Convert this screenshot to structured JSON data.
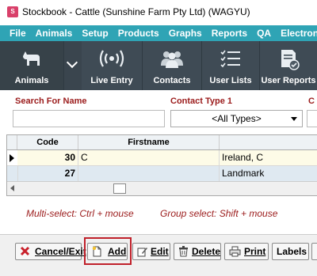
{
  "window": {
    "title": "Stockbook - Cattle (Sunshine Farm Pty Ltd) (WAGYU)",
    "icon": "app-logo-icon"
  },
  "menu": [
    {
      "label": "File"
    },
    {
      "label": "Animals"
    },
    {
      "label": "Setup"
    },
    {
      "label": "Products"
    },
    {
      "label": "Graphs"
    },
    {
      "label": "Reports"
    },
    {
      "label": "QA"
    },
    {
      "label": "Electronic"
    }
  ],
  "toolbar": {
    "animals": {
      "label": "Animals",
      "icon": "cow-icon"
    },
    "live_entry": {
      "label": "Live Entry",
      "icon": "wireless-signal-icon"
    },
    "contacts": {
      "label": "Contacts",
      "icon": "people-icon"
    },
    "user_lists": {
      "label": "User Lists",
      "icon": "checklist-icon"
    },
    "user_reports": {
      "label": "User Reports",
      "icon": "report-icon"
    }
  },
  "search": {
    "name_label": "Search For Name",
    "name_value": "",
    "contact_type_label": "Contact Type 1",
    "contact_type_value": "<All Types>",
    "third_label": "C"
  },
  "grid": {
    "columns": [
      "Code",
      "Firstname",
      ""
    ],
    "rows": [
      {
        "code": "30",
        "firstname": "C",
        "last": "Ireland, C",
        "current": true
      },
      {
        "code": "27",
        "firstname": "",
        "last": "Landmark",
        "current": false
      }
    ]
  },
  "hints": {
    "multi": "Multi-select: Ctrl + mouse",
    "group": "Group select: Shift + mouse"
  },
  "buttons": {
    "cancel": {
      "label": "Cancel/Exit",
      "icon": "x-icon"
    },
    "add": {
      "label": "Add",
      "icon": "new-document-icon"
    },
    "edit": {
      "label": "Edit",
      "icon": "edit-icon"
    },
    "delete": {
      "label": "Delete",
      "icon": "trash-icon"
    },
    "print": {
      "label": "Print",
      "icon": "printer-icon"
    },
    "labels": {
      "label": "Labels"
    }
  },
  "colors": {
    "menubar": "#2fa4b5",
    "toolbar": "#3f4b55",
    "label_red": "#9b1b1b",
    "highlight": "#c0202a"
  }
}
